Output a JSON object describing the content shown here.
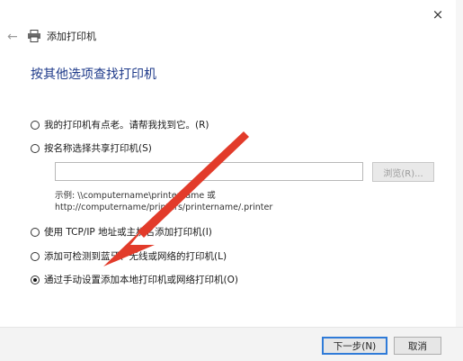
{
  "window": {
    "title": "添加打印机",
    "close_icon": "×",
    "back_icon": "←"
  },
  "heading": "按其他选项查找打印机",
  "options": [
    {
      "label": "我的打印机有点老。请帮我找到它。(R)",
      "checked": false
    },
    {
      "label": "按名称选择共享打印机(S)",
      "checked": false
    },
    {
      "label": "使用 TCP/IP 地址或主机名添加打印机(I)",
      "checked": false
    },
    {
      "label": "添加可检测到蓝牙、无线或网络的打印机(L)",
      "checked": false
    },
    {
      "label": "通过手动设置添加本地打印机或网络打印机(O)",
      "checked": true
    }
  ],
  "share": {
    "input_value": "",
    "browse_label": "浏览(R)...",
    "example_line1": "示例: \\\\computername\\printername 或",
    "example_line2": "http://computername/printers/printername/.printer"
  },
  "footer": {
    "next_label": "下一步(N)",
    "cancel_label": "取消"
  },
  "annotation": {
    "arrow_color": "#e23b2a"
  }
}
